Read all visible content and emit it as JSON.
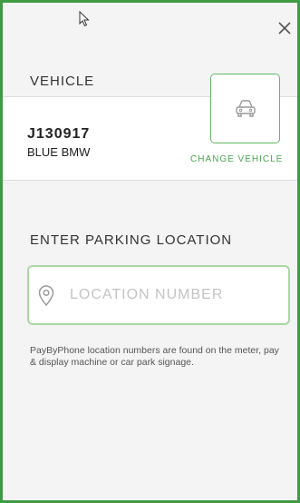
{
  "close": {
    "icon": "close-icon"
  },
  "vehicle": {
    "section_label": "VEHICLE",
    "plate": "J130917",
    "description": "BLUE BMW",
    "change_label": "CHANGE VEHICLE",
    "icon": "car-icon"
  },
  "parking": {
    "section_label": "ENTER PARKING LOCATION",
    "placeholder": "LOCATION NUMBER",
    "icon": "location-pin-icon",
    "help": "PayByPhone location numbers are found on the meter, pay & display machine or car park signage."
  },
  "colors": {
    "accent": "#4aa64e",
    "field_border": "#a9d8a3",
    "background": "#f4f4f4"
  }
}
